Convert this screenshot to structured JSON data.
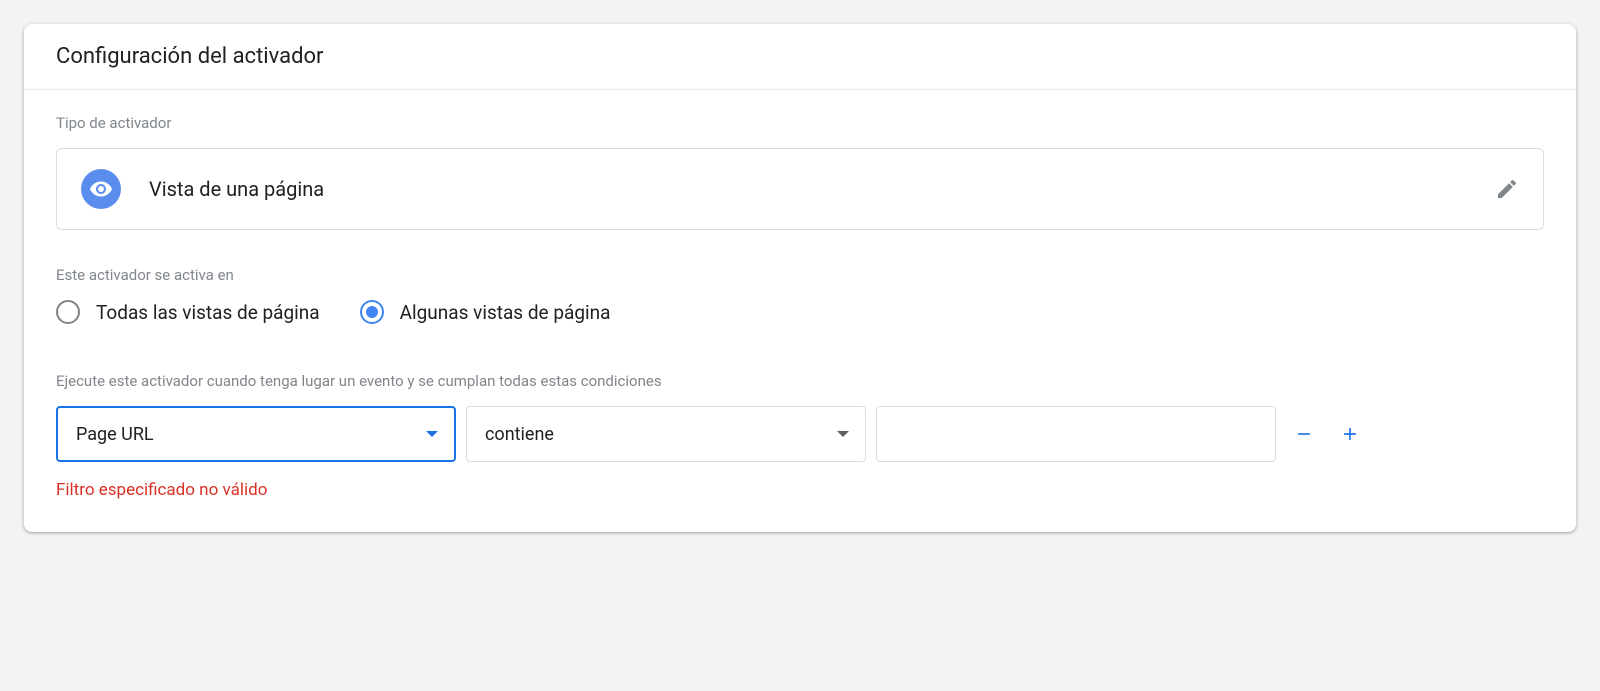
{
  "header": {
    "title": "Configuración del activador"
  },
  "triggerType": {
    "sectionLabel": "Tipo de activador",
    "value": "Vista de una página"
  },
  "firesOn": {
    "sectionLabel": "Este activador se activa en",
    "options": {
      "all": "Todas las vistas de página",
      "some": "Algunas vistas de página"
    },
    "selected": "some"
  },
  "conditions": {
    "sectionLabel": "Ejecute este activador cuando tenga lugar un evento y se cumplan todas estas condiciones",
    "variable": "Page URL",
    "operator": "contiene",
    "value": ""
  },
  "error": "Filtro especificado no válido"
}
